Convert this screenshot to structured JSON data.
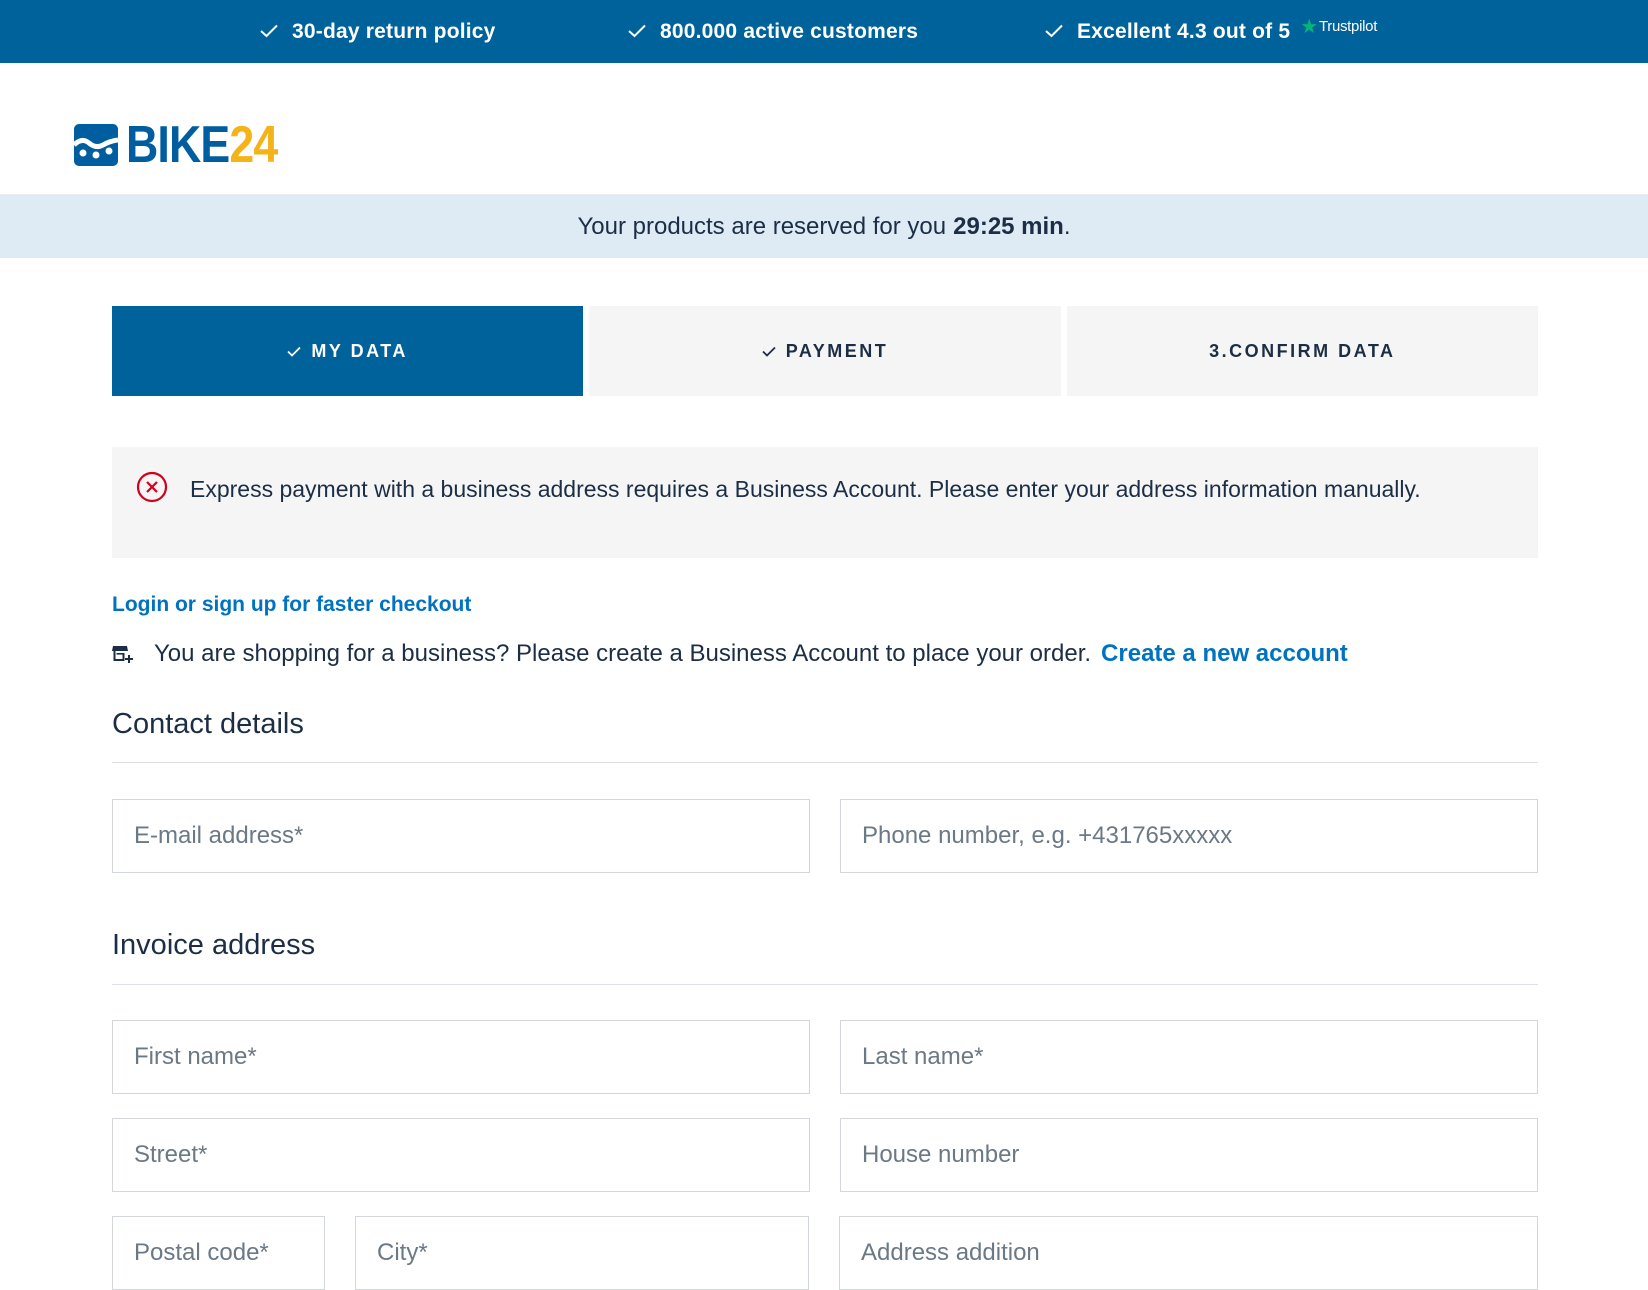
{
  "usp": {
    "items": [
      "30-day return policy",
      "800.000 active customers",
      "Excellent 4.3 out of 5"
    ],
    "trustpilot": "Trustpilot"
  },
  "logo": {
    "brand_main": "BIKE",
    "brand_num": "24"
  },
  "reservation": {
    "prefix": "Your products are reserved for you",
    "time": "29:25 min",
    "suffix": "."
  },
  "steps": [
    {
      "label": "MY DATA"
    },
    {
      "label": "PAYMENT"
    },
    {
      "label": "3.CONFIRM DATA"
    }
  ],
  "error": {
    "message": "Express payment with a business address requires a Business Account. Please enter your address information manually."
  },
  "login_link": "Login or sign up for faster checkout",
  "business": {
    "text": "You are shopping for a business? Please create a Business Account to place your order.",
    "link": "Create a new account"
  },
  "contact": {
    "title": "Contact details",
    "email_placeholder": "E-mail address*",
    "phone_placeholder": "Phone number, e.g. +431765xxxxx"
  },
  "invoice": {
    "title": "Invoice address",
    "first_name_placeholder": "First name*",
    "last_name_placeholder": "Last name*",
    "street_placeholder": "Street*",
    "house_number_placeholder": "House number",
    "postal_code_placeholder": "Postal code*",
    "city_placeholder": "City*",
    "address_addition_placeholder": "Address addition"
  },
  "colors": {
    "primary": "#00629a",
    "link": "#0073c0",
    "error": "#d0021b",
    "logo_yellow": "#f5b31a",
    "trustpilot": "#00b67a"
  }
}
